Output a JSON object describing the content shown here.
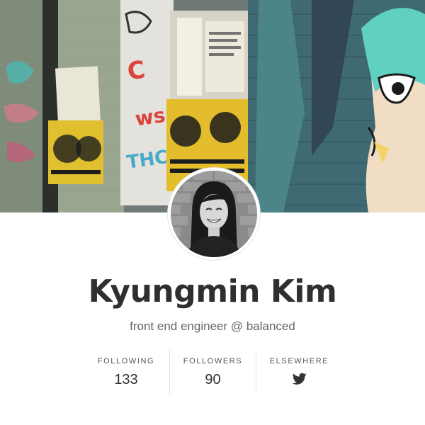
{
  "cover": {
    "icon": "graffiti-cover-image"
  },
  "profile": {
    "avatar_icon": "profile-photo",
    "name": "Kyungmin Kim",
    "tagline": "front end engineer @ balanced"
  },
  "stats": {
    "following": {
      "label": "FOLLOWING",
      "value": "133"
    },
    "followers": {
      "label": "FOLLOWERS",
      "value": "90"
    },
    "elsewhere": {
      "label": "ELSEWHERE",
      "icon": "twitter-icon"
    }
  },
  "colors": {
    "name_text": "#2f2f2f",
    "tagline_text": "#666666",
    "divider": "#e3e3e3"
  }
}
